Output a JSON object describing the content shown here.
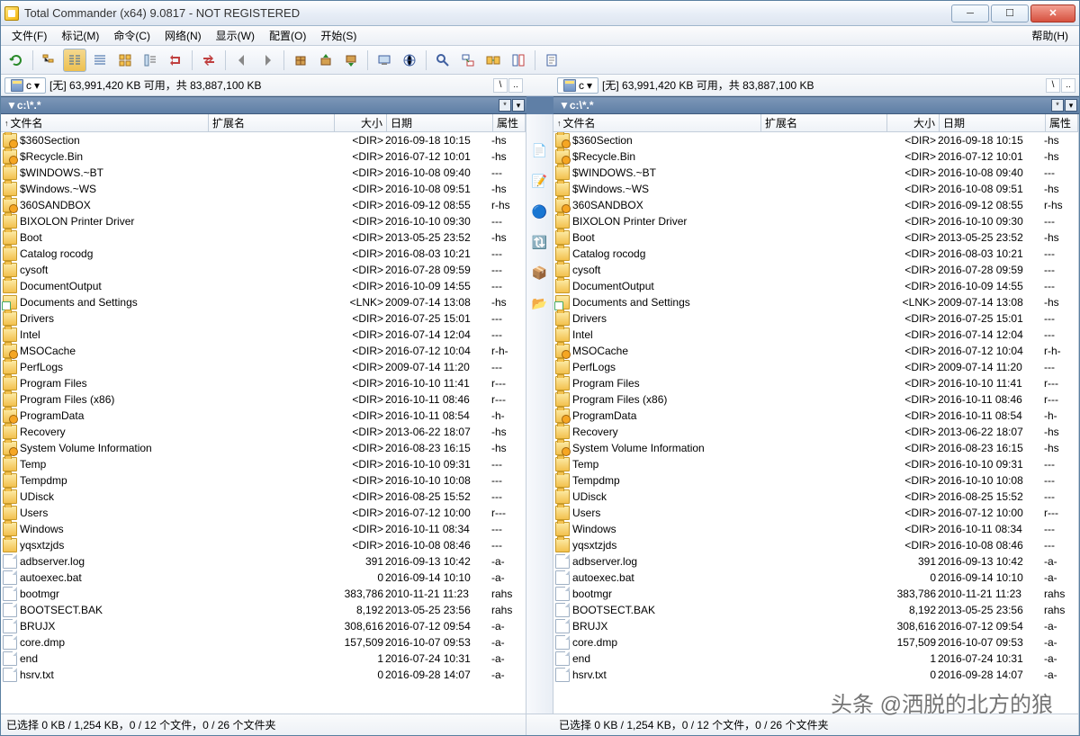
{
  "window": {
    "title": "Total Commander (x64) 9.0817 - NOT REGISTERED"
  },
  "menu": {
    "file": "文件(F)",
    "mark": "标记(M)",
    "commands": "命令(C)",
    "net": "网络(N)",
    "show": "显示(W)",
    "config": "配置(O)",
    "start": "开始(S)",
    "help": "帮助(H)"
  },
  "drive": {
    "label": "c",
    "info": "[无]  63,991,420 KB 可用，共 83,887,100 KB"
  },
  "path": "▼c:\\*.*",
  "columns": {
    "name": "文件名",
    "ext": "扩展名",
    "size": "大小",
    "date": "日期",
    "attr": "属性"
  },
  "status": "已选择 0 KB / 1,254 KB，0 / 12 个文件，0 / 26 个文件夹",
  "watermark": "头条 @洒脱的北方的狼",
  "files": [
    {
      "icon": "folder locked",
      "name": "$360Section",
      "ext": "",
      "size": "<DIR>",
      "date": "2016-09-18 10:15",
      "attr": "-hs"
    },
    {
      "icon": "folder locked",
      "name": "$Recycle.Bin",
      "ext": "",
      "size": "<DIR>",
      "date": "2016-07-12 10:01",
      "attr": "-hs"
    },
    {
      "icon": "folder",
      "name": "$WINDOWS.~BT",
      "ext": "",
      "size": "<DIR>",
      "date": "2016-10-08 09:40",
      "attr": "---"
    },
    {
      "icon": "folder",
      "name": "$Windows.~WS",
      "ext": "",
      "size": "<DIR>",
      "date": "2016-10-08 09:51",
      "attr": "-hs"
    },
    {
      "icon": "folder locked",
      "name": "360SANDBOX",
      "ext": "",
      "size": "<DIR>",
      "date": "2016-09-12 08:55",
      "attr": "r-hs"
    },
    {
      "icon": "folder",
      "name": "BIXOLON Printer Driver",
      "ext": "",
      "size": "<DIR>",
      "date": "2016-10-10 09:30",
      "attr": "---"
    },
    {
      "icon": "folder",
      "name": "Boot",
      "ext": "",
      "size": "<DIR>",
      "date": "2013-05-25 23:52",
      "attr": "-hs"
    },
    {
      "icon": "folder",
      "name": "Catalog rocodg",
      "ext": "",
      "size": "<DIR>",
      "date": "2016-08-03 10:21",
      "attr": "---"
    },
    {
      "icon": "folder",
      "name": "cysoft",
      "ext": "",
      "size": "<DIR>",
      "date": "2016-07-28 09:59",
      "attr": "---"
    },
    {
      "icon": "folder",
      "name": "DocumentOutput",
      "ext": "",
      "size": "<DIR>",
      "date": "2016-10-09 14:55",
      "attr": "---"
    },
    {
      "icon": "link",
      "name": "Documents and Settings",
      "ext": "",
      "size": "<LNK>",
      "date": "2009-07-14 13:08",
      "attr": "-hs"
    },
    {
      "icon": "folder",
      "name": "Drivers",
      "ext": "",
      "size": "<DIR>",
      "date": "2016-07-25 15:01",
      "attr": "---"
    },
    {
      "icon": "folder",
      "name": "Intel",
      "ext": "",
      "size": "<DIR>",
      "date": "2016-07-14 12:04",
      "attr": "---"
    },
    {
      "icon": "folder locked",
      "name": "MSOCache",
      "ext": "",
      "size": "<DIR>",
      "date": "2016-07-12 10:04",
      "attr": "r-h-"
    },
    {
      "icon": "folder",
      "name": "PerfLogs",
      "ext": "",
      "size": "<DIR>",
      "date": "2009-07-14 11:20",
      "attr": "---"
    },
    {
      "icon": "folder",
      "name": "Program Files",
      "ext": "",
      "size": "<DIR>",
      "date": "2016-10-10 11:41",
      "attr": "r---"
    },
    {
      "icon": "folder",
      "name": "Program Files (x86)",
      "ext": "",
      "size": "<DIR>",
      "date": "2016-10-11 08:46",
      "attr": "r---"
    },
    {
      "icon": "folder locked",
      "name": "ProgramData",
      "ext": "",
      "size": "<DIR>",
      "date": "2016-10-11 08:54",
      "attr": "-h-"
    },
    {
      "icon": "folder",
      "name": "Recovery",
      "ext": "",
      "size": "<DIR>",
      "date": "2013-06-22 18:07",
      "attr": "-hs"
    },
    {
      "icon": "folder locked",
      "name": "System Volume Information",
      "ext": "",
      "size": "<DIR>",
      "date": "2016-08-23 16:15",
      "attr": "-hs"
    },
    {
      "icon": "folder",
      "name": "Temp",
      "ext": "",
      "size": "<DIR>",
      "date": "2016-10-10 09:31",
      "attr": "---"
    },
    {
      "icon": "folder",
      "name": "Tempdmp",
      "ext": "",
      "size": "<DIR>",
      "date": "2016-10-10 10:08",
      "attr": "---"
    },
    {
      "icon": "folder",
      "name": "UDisck",
      "ext": "",
      "size": "<DIR>",
      "date": "2016-08-25 15:52",
      "attr": "---"
    },
    {
      "icon": "folder",
      "name": "Users",
      "ext": "",
      "size": "<DIR>",
      "date": "2016-07-12 10:00",
      "attr": "r---"
    },
    {
      "icon": "folder",
      "name": "Windows",
      "ext": "",
      "size": "<DIR>",
      "date": "2016-10-11 08:34",
      "attr": "---"
    },
    {
      "icon": "folder",
      "name": "yqsxtzjds",
      "ext": "",
      "size": "<DIR>",
      "date": "2016-10-08 08:46",
      "attr": "---"
    },
    {
      "icon": "file",
      "name": "adbserver.log",
      "ext": "",
      "size": "391",
      "date": "2016-09-13 10:42",
      "attr": "-a-"
    },
    {
      "icon": "file",
      "name": "autoexec.bat",
      "ext": "",
      "size": "0",
      "date": "2016-09-14 10:10",
      "attr": "-a-"
    },
    {
      "icon": "file",
      "name": "bootmgr",
      "ext": "",
      "size": "383,786",
      "date": "2010-11-21 11:23",
      "attr": "rahs"
    },
    {
      "icon": "file",
      "name": "BOOTSECT.BAK",
      "ext": "",
      "size": "8,192",
      "date": "2013-05-25 23:56",
      "attr": "rahs"
    },
    {
      "icon": "file",
      "name": "BRUJX",
      "ext": "",
      "size": "308,616",
      "date": "2016-07-12 09:54",
      "attr": "-a-"
    },
    {
      "icon": "file",
      "name": "core.dmp",
      "ext": "",
      "size": "157,509",
      "date": "2016-10-07 09:53",
      "attr": "-a-"
    },
    {
      "icon": "file",
      "name": "end",
      "ext": "",
      "size": "1",
      "date": "2016-07-24 10:31",
      "attr": "-a-"
    },
    {
      "icon": "file",
      "name": "hsrv.txt",
      "ext": "",
      "size": "0",
      "date": "2016-09-28 14:07",
      "attr": "-a-"
    }
  ],
  "midicons": [
    "📄",
    "📝",
    "🔵",
    "🔃",
    "📦",
    "📂"
  ],
  "tbicons": [
    "refresh",
    "tree",
    "brief",
    "full",
    "thumbs",
    "reverse",
    "tree2",
    "swap",
    "arrow-left",
    "arrow-right",
    "pack",
    "unpack",
    "archive",
    "ftp",
    "network",
    "search",
    "find",
    "sync",
    "compare",
    "notepad"
  ]
}
